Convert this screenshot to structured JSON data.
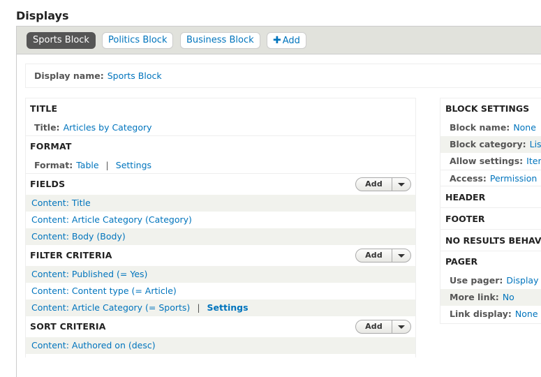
{
  "page": {
    "title": "Displays"
  },
  "tabs": [
    {
      "label": "Sports Block",
      "active": true
    },
    {
      "label": "Politics Block",
      "active": false
    },
    {
      "label": "Business Block",
      "active": false
    },
    {
      "label": "Add",
      "icon": "plus-icon"
    }
  ],
  "display_name": {
    "label": "Display name:",
    "value": "Sports Block"
  },
  "left": {
    "title": {
      "heading": "TITLE",
      "label": "Title:",
      "value": "Articles by Category"
    },
    "format": {
      "heading": "FORMAT",
      "label": "Format:",
      "value": "Table",
      "separator": "|",
      "settings": "Settings"
    },
    "fields": {
      "heading": "FIELDS",
      "add_label": "Add",
      "items": [
        "Content: Title",
        "Content: Article Category (Category)",
        "Content: Body (Body)"
      ]
    },
    "filter_criteria": {
      "heading": "FILTER CRITERIA",
      "add_label": "Add",
      "items": [
        "Content: Published (= Yes)",
        "Content: Content type (= Article)",
        "Content: Article Category (= Sports)"
      ],
      "separator": "|",
      "settings": "Settings"
    },
    "sort_criteria": {
      "heading": "SORT CRITERIA",
      "add_label": "Add",
      "items": [
        "Content: Authored on (desc)"
      ]
    }
  },
  "right": {
    "block_settings": {
      "heading": "BLOCK SETTINGS",
      "rows": [
        {
          "label": "Block name:",
          "value": "None"
        },
        {
          "label": "Block category:",
          "value": "Lists (Views)"
        },
        {
          "label": "Allow settings:",
          "value": "Items per page"
        },
        {
          "label": "Access:",
          "value": "Permission"
        }
      ]
    },
    "header": {
      "heading": "HEADER"
    },
    "footer": {
      "heading": "FOOTER"
    },
    "no_results": {
      "heading": "NO RESULTS BEHAVIOR"
    },
    "pager": {
      "heading": "PAGER",
      "rows": [
        {
          "label": "Use pager:",
          "value": "Display a specified number of items"
        },
        {
          "label": "More link:",
          "value": "No"
        },
        {
          "label": "Link display:",
          "value": "None"
        }
      ]
    }
  }
}
